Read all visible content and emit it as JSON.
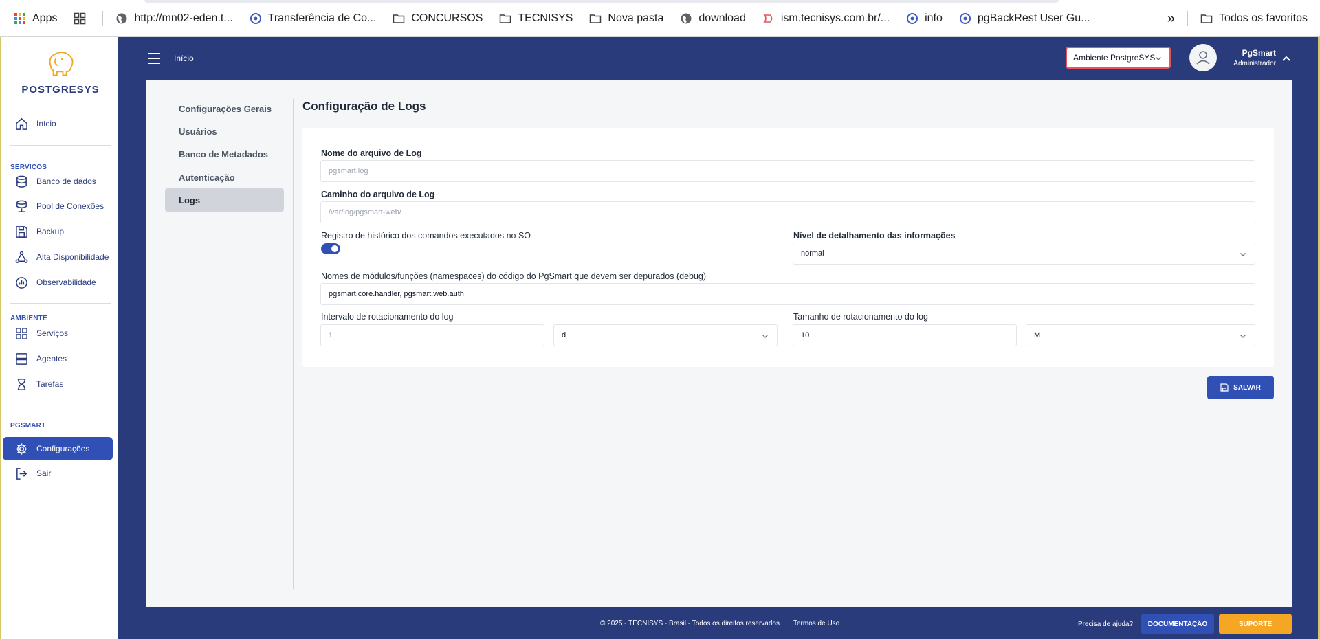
{
  "bookmarks": {
    "items": [
      {
        "label": "Apps",
        "icon": "apps-grid-icon"
      },
      {
        "label": "",
        "icon": "shortcut-grid-icon"
      },
      {
        "label": "http://mn02-eden.t...",
        "icon": "globe-icon"
      },
      {
        "label": "Transferência de Co...",
        "icon": "site-icon"
      },
      {
        "label": "CONCURSOS",
        "icon": "folder-icon"
      },
      {
        "label": "TECNISYS",
        "icon": "folder-icon"
      },
      {
        "label": "Nova pasta",
        "icon": "folder-icon"
      },
      {
        "label": "download",
        "icon": "globe-icon"
      },
      {
        "label": "ism.tecnisys.com.br/...",
        "icon": "site-icon"
      },
      {
        "label": "info",
        "icon": "site-icon"
      },
      {
        "label": "pgBackRest User Gu...",
        "icon": "site-icon"
      }
    ],
    "more": "»",
    "all_bookmarks": "Todos os favoritos"
  },
  "logo": {
    "text": "POSTGRESYS"
  },
  "sidebar": {
    "home": "Início",
    "section_services": "SERVIÇOS",
    "services": [
      "Banco de dados",
      "Pool de Conexões",
      "Backup",
      "Alta Disponibilidade",
      "Observabilidade"
    ],
    "section_environment": "AMBIENTE",
    "environment": [
      "Serviços",
      "Agentes",
      "Tarefas"
    ],
    "section_pgsmart": "PGSMART",
    "pgsmart": [
      "Configurações",
      "Sair"
    ]
  },
  "header": {
    "title": "Início",
    "environment_select": "Ambiente PostgreSYS",
    "user_name": "PgSmart",
    "user_role": "Administrador"
  },
  "settings_nav": [
    "Configurações Gerais",
    "Usuários",
    "Banco de Metadados",
    "Autenticação",
    "Logs"
  ],
  "form": {
    "title": "Configuração de Logs",
    "log_file_name_label": "Nome do arquivo de Log",
    "log_file_name_placeholder": "pgsmart.log",
    "log_file_path_label": "Caminho do arquivo de Log",
    "log_file_path_placeholder": "/var/log/pgsmart-web/",
    "history_label": "Registro de histórico dos comandos executados no SO",
    "history_enabled": true,
    "detail_level_label": "Nível de detalhamento das informações",
    "detail_level_value": "normal",
    "debug_modules_label": "Nomes de módulos/funções (namespaces) do código do PgSmart que devem ser depurados (debug)",
    "debug_modules_value": "pgsmart.core.handler, pgsmart.web.auth",
    "rotation_interval_label": "Intervalo de rotacionamento do log",
    "rotation_interval_value": "1",
    "rotation_interval_unit": "d",
    "rotation_size_label": "Tamanho de rotacionamento do log",
    "rotation_size_value": "10",
    "rotation_size_unit": "M",
    "save_label": "SALVAR"
  },
  "footer": {
    "copyright": "© 2025 - TECNISYS - Brasil - Todos os direitos reservados",
    "terms": "Termos de Uso",
    "help": "Precisa de ajuda?",
    "docs": "DOCUMENTAÇÃO",
    "support": "SUPORTE"
  },
  "colors": {
    "primary": "#2a3b7c",
    "accent": "#3150b6",
    "support": "#f5a623",
    "alert_border": "#e8535a"
  }
}
